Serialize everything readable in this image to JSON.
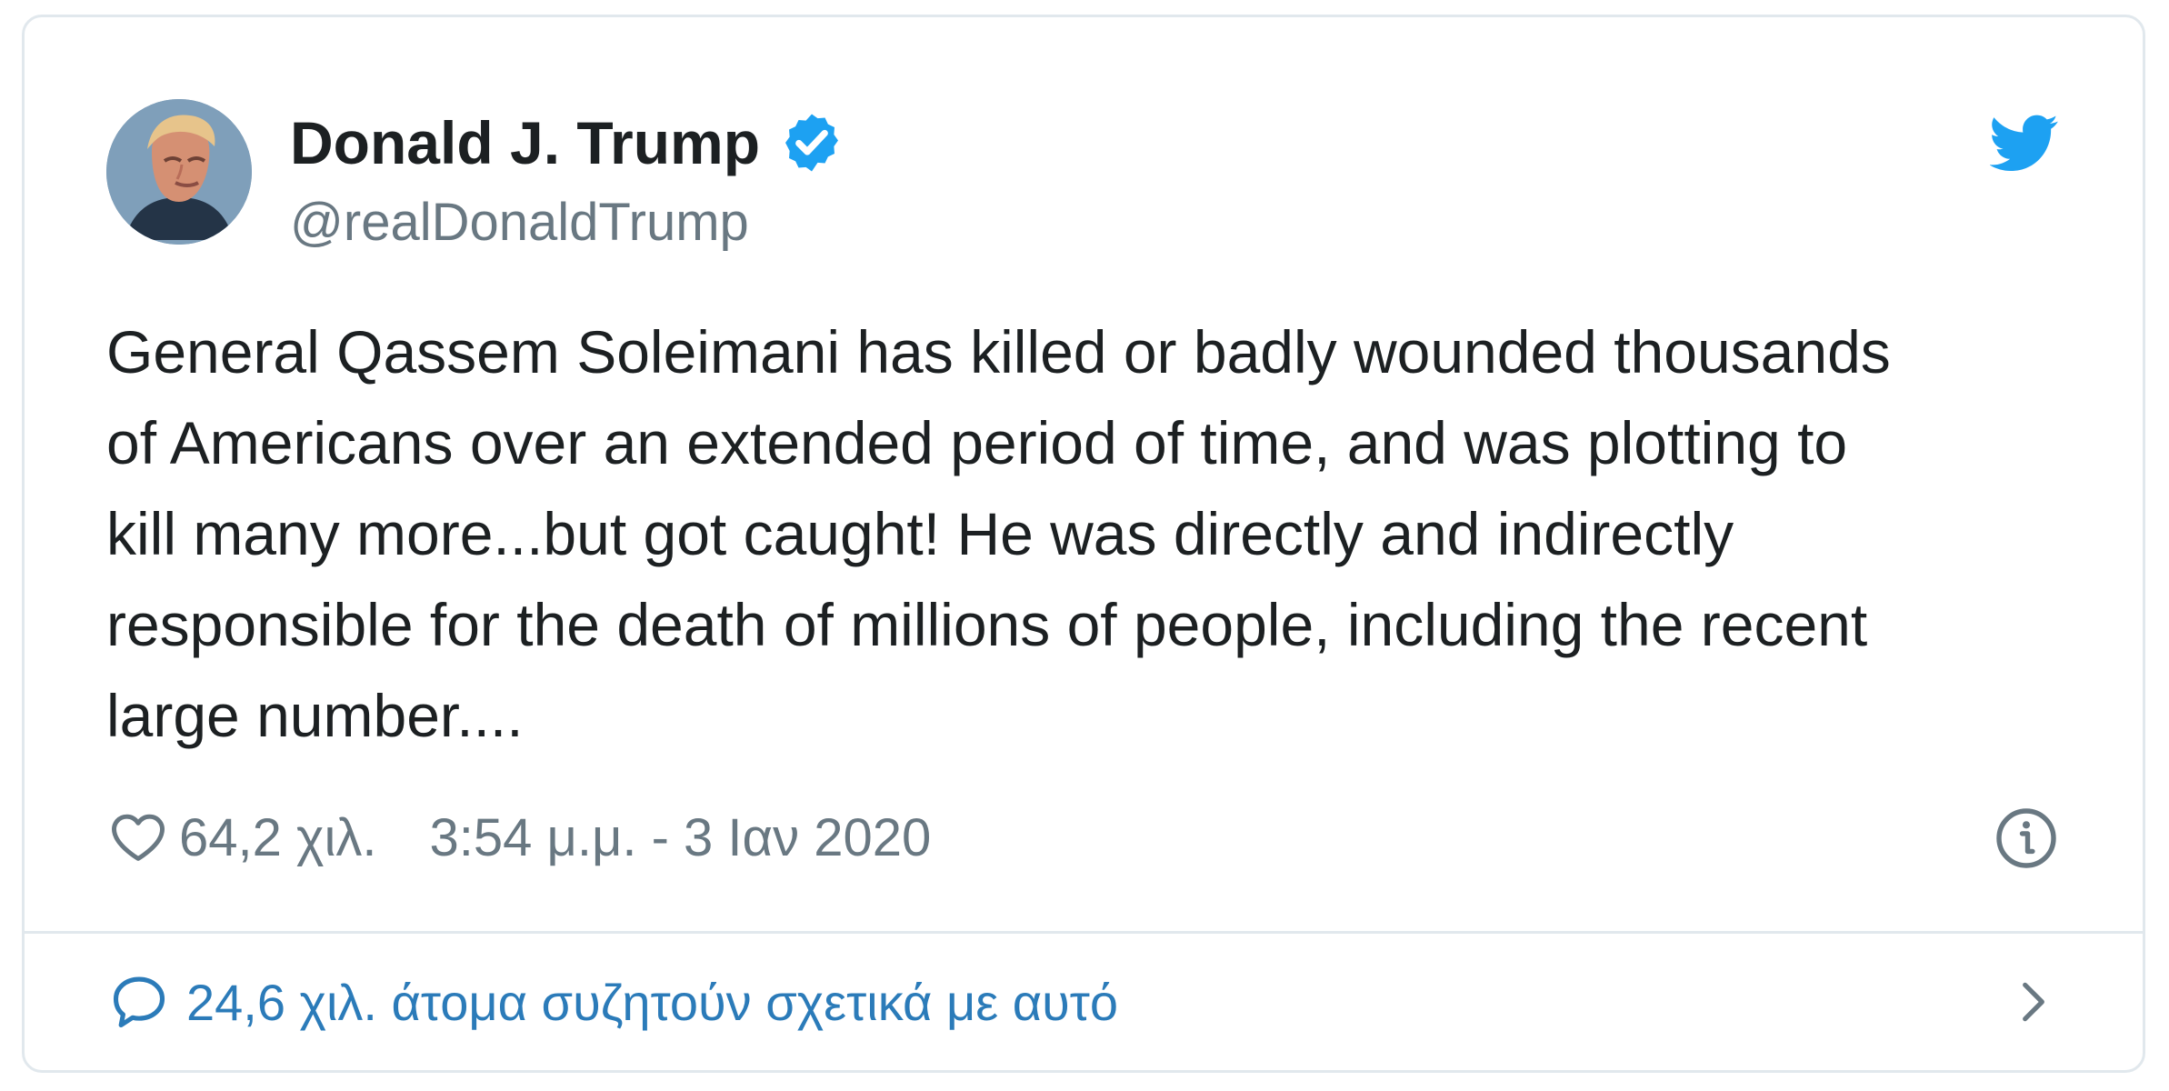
{
  "tweet": {
    "author_name": "Donald J. Trump",
    "author_handle": "@realDonaldTrump",
    "text": "General Qassem Soleimani has killed or badly wounded thousands\nof Americans over an extended period of time, and was plotting to\nkill many more...but got caught! He was directly and indirectly\nresponsible for the death of millions of people, including the recent\nlarge number....",
    "like_count": "64,2 χιλ.",
    "timestamp": "3:54 μ.μ. - 3 Ιαν 2020",
    "discussion_text": "24,6 χιλ. άτομα συζητούν σχετικά με αυτό"
  },
  "icons": {
    "verified": "verified-badge-icon",
    "platform": "twitter-bird-icon",
    "like": "heart-icon",
    "info": "info-icon",
    "reply": "reply-bubble-icon",
    "chevron": "chevron-right-icon"
  },
  "colors": {
    "text": "#1c2022",
    "muted": "#697882",
    "link": "#2b7bb9",
    "brand": "#1da1f2",
    "border": "#e1e8ed"
  }
}
